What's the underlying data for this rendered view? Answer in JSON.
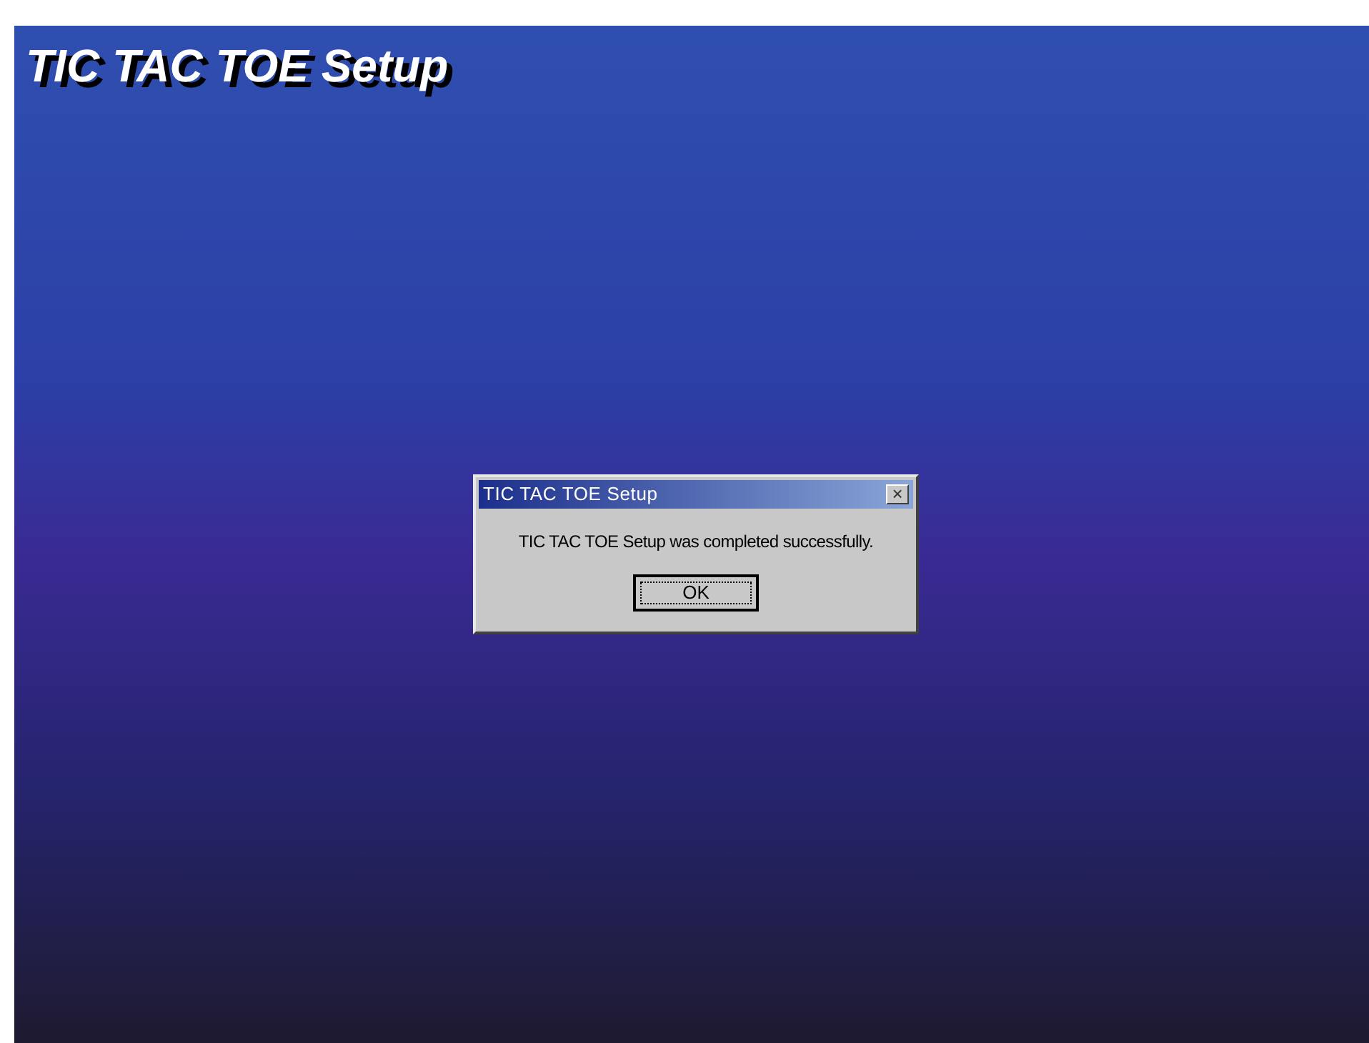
{
  "screen": {
    "title": "TIC TAC TOE Setup"
  },
  "dialog": {
    "title": "TIC TAC TOE Setup",
    "close": "×",
    "message": "TIC TAC TOE Setup was completed successfully.",
    "buttons": [
      {
        "label": "OK",
        "default": true
      }
    ]
  }
}
